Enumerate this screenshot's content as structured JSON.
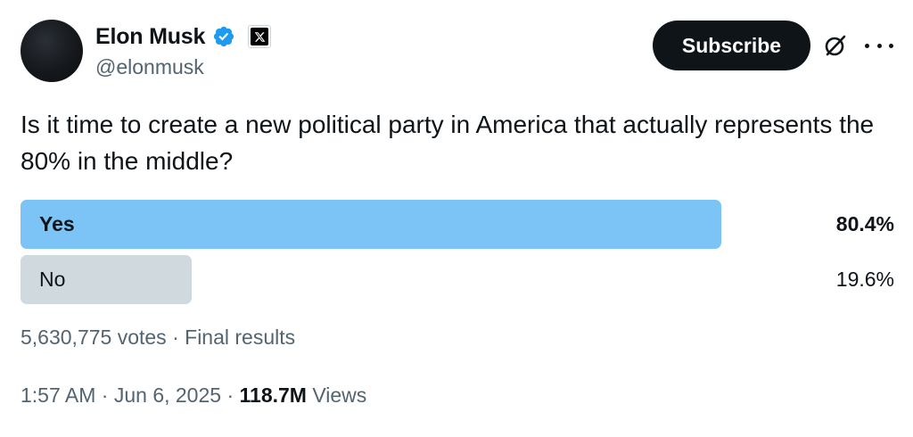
{
  "author": {
    "name": "Elon Musk",
    "handle": "@elonmusk",
    "verified_color": "#1d9bf0"
  },
  "actions": {
    "subscribe_label": "Subscribe",
    "grok_icon": "grok-icon",
    "more_icon": "more-icon"
  },
  "tweet": {
    "text": "Is it time to create a new political party in America that actually represents the 80% in the middle?"
  },
  "poll": {
    "options": [
      {
        "label": "Yes",
        "percent": "80.4%",
        "fraction": 0.804,
        "winner": true,
        "color": "#7bc4f5"
      },
      {
        "label": "No",
        "percent": "19.6%",
        "fraction": 0.196,
        "winner": false,
        "color": "#cfd9de"
      }
    ],
    "votes": "5,630,775 votes",
    "status": "Final results"
  },
  "meta": {
    "time": "1:57 AM",
    "date": "Jun 6, 2025",
    "views_count": "118.7M",
    "views_label": "Views"
  }
}
